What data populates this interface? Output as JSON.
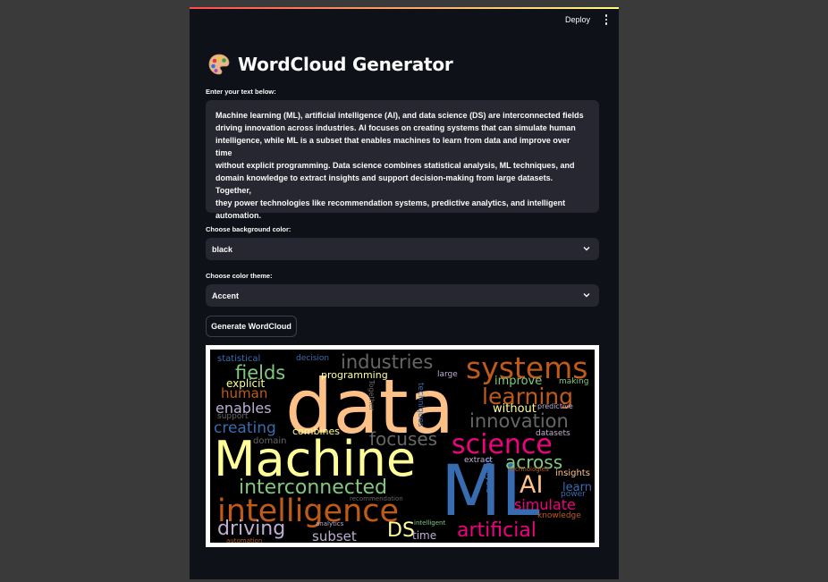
{
  "header": {
    "deploy_label": "Deploy",
    "menu_icon": "more-vertical-icon"
  },
  "page": {
    "title": "WordCloud Generator",
    "title_icon": "palette-icon"
  },
  "text_input": {
    "label": "Enter your text below:",
    "lines": [
      "Machine learning (ML), artificial intelligence (AI), and data science (DS) are interconnected fields",
      "driving innovation across industries. AI focuses on creating systems that can simulate human",
      "intelligence, while ML is a subset that enables machines to learn from data and improve over time",
      "without explicit programming. Data science combines statistical analysis, ML techniques, and",
      "domain knowledge to extract insights and support decision-making from large datasets. Together,",
      "they power technologies like recommendation systems, predictive analytics, and intelligent",
      "automation."
    ]
  },
  "background_select": {
    "label": "Choose background color:",
    "value": "black"
  },
  "theme_select": {
    "label": "Choose color theme:",
    "value": "Accent"
  },
  "generate_button": {
    "label": "Generate WordCloud"
  },
  "wordcloud": {
    "background": "#000000",
    "words": [
      {
        "id": "data",
        "text": "data",
        "color": "#fdc086"
      },
      {
        "id": "machine",
        "text": "Machine",
        "color": "#ffff99"
      },
      {
        "id": "ml",
        "text": "ML",
        "color": "#386cb0"
      },
      {
        "id": "intelligence",
        "text": "intelligence",
        "color": "#bf5b17"
      },
      {
        "id": "systems",
        "text": "systems",
        "color": "#bf5b17"
      },
      {
        "id": "science",
        "text": "science",
        "color": "#f0027f"
      },
      {
        "id": "learning",
        "text": "learning",
        "color": "#bf5b17"
      },
      {
        "id": "interconnected",
        "text": "interconnected",
        "color": "#7fc97f"
      },
      {
        "id": "artificial",
        "text": "artificial",
        "color": "#f0027f"
      },
      {
        "id": "industries",
        "text": "industries",
        "color": "#666666"
      },
      {
        "id": "fields",
        "text": "fields",
        "color": "#7fc97f"
      },
      {
        "id": "innovation",
        "text": "innovation",
        "color": "#666666"
      },
      {
        "id": "driving",
        "text": "driving",
        "color": "#beaed4"
      },
      {
        "id": "focuses",
        "text": "focuses",
        "color": "#666666"
      },
      {
        "id": "across",
        "text": "across",
        "color": "#7fc97f"
      },
      {
        "id": "ai",
        "text": "AI",
        "color": "#fdc086"
      },
      {
        "id": "ds",
        "text": "DS",
        "color": "#ffff99"
      },
      {
        "id": "creating",
        "text": "creating",
        "color": "#386cb0"
      },
      {
        "id": "simulate",
        "text": "simulate",
        "color": "#f0027f"
      },
      {
        "id": "enables",
        "text": "enables",
        "color": "#beaed4"
      },
      {
        "id": "human",
        "text": "human",
        "color": "#bf5b17"
      },
      {
        "id": "subset",
        "text": "subset",
        "color": "#beaed4"
      },
      {
        "id": "learn",
        "text": "learn",
        "color": "#386cb0"
      },
      {
        "id": "improve",
        "text": "improve",
        "color": "#7fc97f"
      },
      {
        "id": "without",
        "text": "without",
        "color": "#ffff99"
      },
      {
        "id": "explicit",
        "text": "explicit",
        "color": "#ffff99"
      },
      {
        "id": "time",
        "text": "time",
        "color": "#beaed4"
      },
      {
        "id": "programming",
        "text": "programming",
        "color": "#ffff99"
      },
      {
        "id": "statistical",
        "text": "statistical",
        "color": "#386cb0"
      },
      {
        "id": "decision",
        "text": "decision",
        "color": "#386cb0"
      },
      {
        "id": "combines",
        "text": "combines",
        "color": "#ffff99"
      },
      {
        "id": "domain",
        "text": "domain",
        "color": "#666666"
      },
      {
        "id": "support",
        "text": "support",
        "color": "#666666"
      },
      {
        "id": "analysis",
        "text": "analysis",
        "color": "#386cb0"
      },
      {
        "id": "together",
        "text": "Together",
        "color": "#666666"
      },
      {
        "id": "techniques",
        "text": "techniques",
        "color": "#386cb0"
      },
      {
        "id": "large",
        "text": "large",
        "color": "#beaed4"
      },
      {
        "id": "making",
        "text": "making",
        "color": "#7fc97f"
      },
      {
        "id": "predictive",
        "text": "predictive",
        "color": "#beaed4"
      },
      {
        "id": "datasets",
        "text": "datasets",
        "color": "#beaed4"
      },
      {
        "id": "extract",
        "text": "extract",
        "color": "#beaed4"
      },
      {
        "id": "insights",
        "text": "insights",
        "color": "#fdc086"
      },
      {
        "id": "technologies",
        "text": "technologies",
        "color": "#bf5b17"
      },
      {
        "id": "power",
        "text": "power",
        "color": "#386cb0"
      },
      {
        "id": "knowledge",
        "text": "knowledge",
        "color": "#bf5b17"
      },
      {
        "id": "recommendation",
        "text": "recommendation",
        "color": "#666666"
      },
      {
        "id": "analytics",
        "text": "analytics",
        "color": "#beaed4"
      },
      {
        "id": "intelligent",
        "text": "intelligent",
        "color": "#7fc97f"
      },
      {
        "id": "automation",
        "text": "automation",
        "color": "#bf5b17"
      }
    ]
  }
}
